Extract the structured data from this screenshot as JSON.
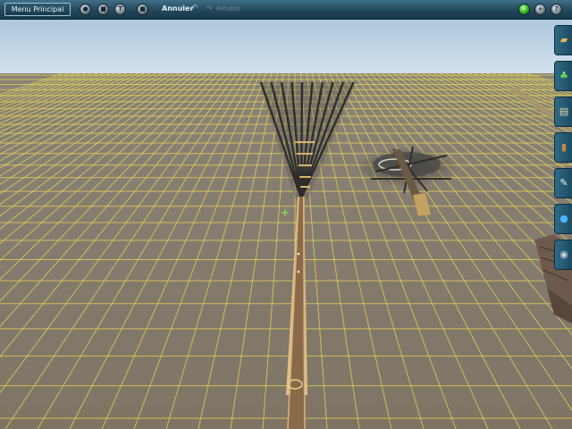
{
  "toolbar": {
    "menu_label": "Menu Principal",
    "undo_label": "Annuler",
    "redo_label": "Rétablir",
    "left_icons": [
      "camera-icon",
      "delete-icon",
      "info-icon",
      "stop-icon"
    ],
    "right_icons": [
      "status-icon",
      "add-icon",
      "help-icon"
    ]
  },
  "side_panel": {
    "tabs": [
      "track-tool-icon",
      "trees-icon",
      "buildings-icon",
      "terrain-paint-icon",
      "wrench-icon",
      "globe-icon",
      "settings-icon"
    ]
  },
  "colors": {
    "toolbar": "#23485c",
    "sky": "#b8cfe3",
    "ground": "#857a6c",
    "grid": "#e8e04a"
  }
}
